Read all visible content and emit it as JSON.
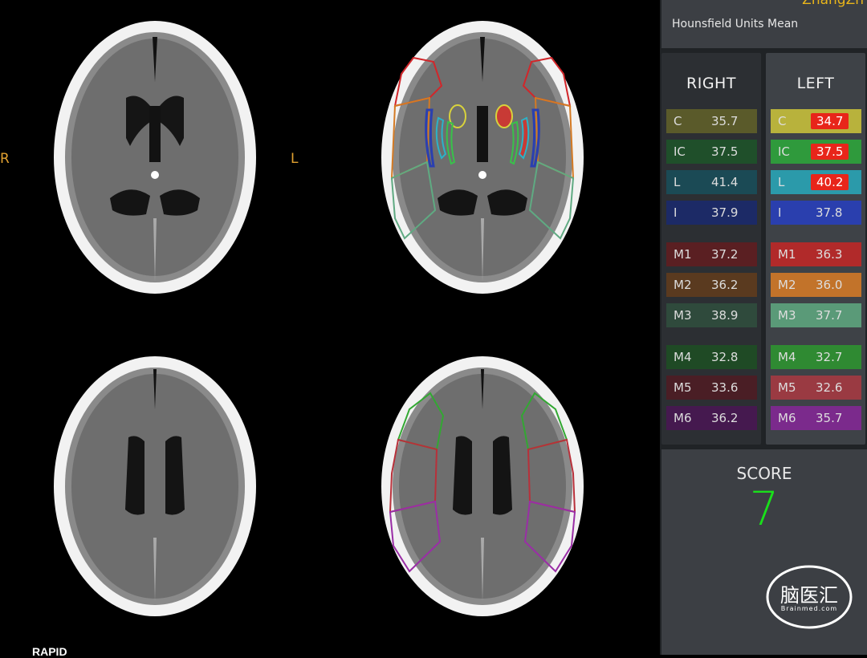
{
  "header": {
    "user": "ZhangZh",
    "title": "Hounsfield Units Mean"
  },
  "viewer": {
    "orientation_right": "R",
    "orientation_left": "L",
    "brand": "RAPID"
  },
  "right_side": {
    "title": "RIGHT",
    "rows": [
      {
        "label": "C",
        "value": "35.7",
        "color": "#5a5a2a"
      },
      {
        "label": "IC",
        "value": "37.5",
        "color": "#1f4f2a"
      },
      {
        "label": "L",
        "value": "41.4",
        "color": "#1b4a55"
      },
      {
        "label": "I",
        "value": "37.9",
        "color": "#1c2a66"
      },
      {
        "label": "M1",
        "value": "37.2",
        "color": "#5a1f22"
      },
      {
        "label": "M2",
        "value": "36.2",
        "color": "#5a3a1f"
      },
      {
        "label": "M3",
        "value": "38.9",
        "color": "#2f4a3c"
      },
      {
        "label": "M4",
        "value": "32.8",
        "color": "#1f4a25"
      },
      {
        "label": "M5",
        "value": "33.6",
        "color": "#4a1e25"
      },
      {
        "label": "M6",
        "value": "36.2",
        "color": "#45194f"
      }
    ]
  },
  "left_side": {
    "title": "LEFT",
    "rows": [
      {
        "label": "C",
        "value": "34.7",
        "color": "#b8b23c",
        "flag": true
      },
      {
        "label": "IC",
        "value": "37.5",
        "color": "#2f9a3c",
        "flag": true
      },
      {
        "label": "L",
        "value": "40.2",
        "color": "#2b9aaa",
        "flag": true
      },
      {
        "label": "I",
        "value": "37.8",
        "color": "#2a3fae",
        "flag": false
      },
      {
        "label": "M1",
        "value": "36.3",
        "color": "#b12a2a",
        "flag": false
      },
      {
        "label": "M2",
        "value": "36.0",
        "color": "#c2732a",
        "flag": false
      },
      {
        "label": "M3",
        "value": "37.7",
        "color": "#5a9a78",
        "flag": false
      },
      {
        "label": "M4",
        "value": "32.7",
        "color": "#2f8a32",
        "flag": false
      },
      {
        "label": "M5",
        "value": "32.6",
        "color": "#9a3a42",
        "flag": false
      },
      {
        "label": "M6",
        "value": "35.7",
        "color": "#7b2a8c",
        "flag": false
      }
    ]
  },
  "score": {
    "label": "SCORE",
    "value": "7"
  },
  "logo": {
    "text": "脑医汇",
    "sub": "Brainmed.com"
  }
}
